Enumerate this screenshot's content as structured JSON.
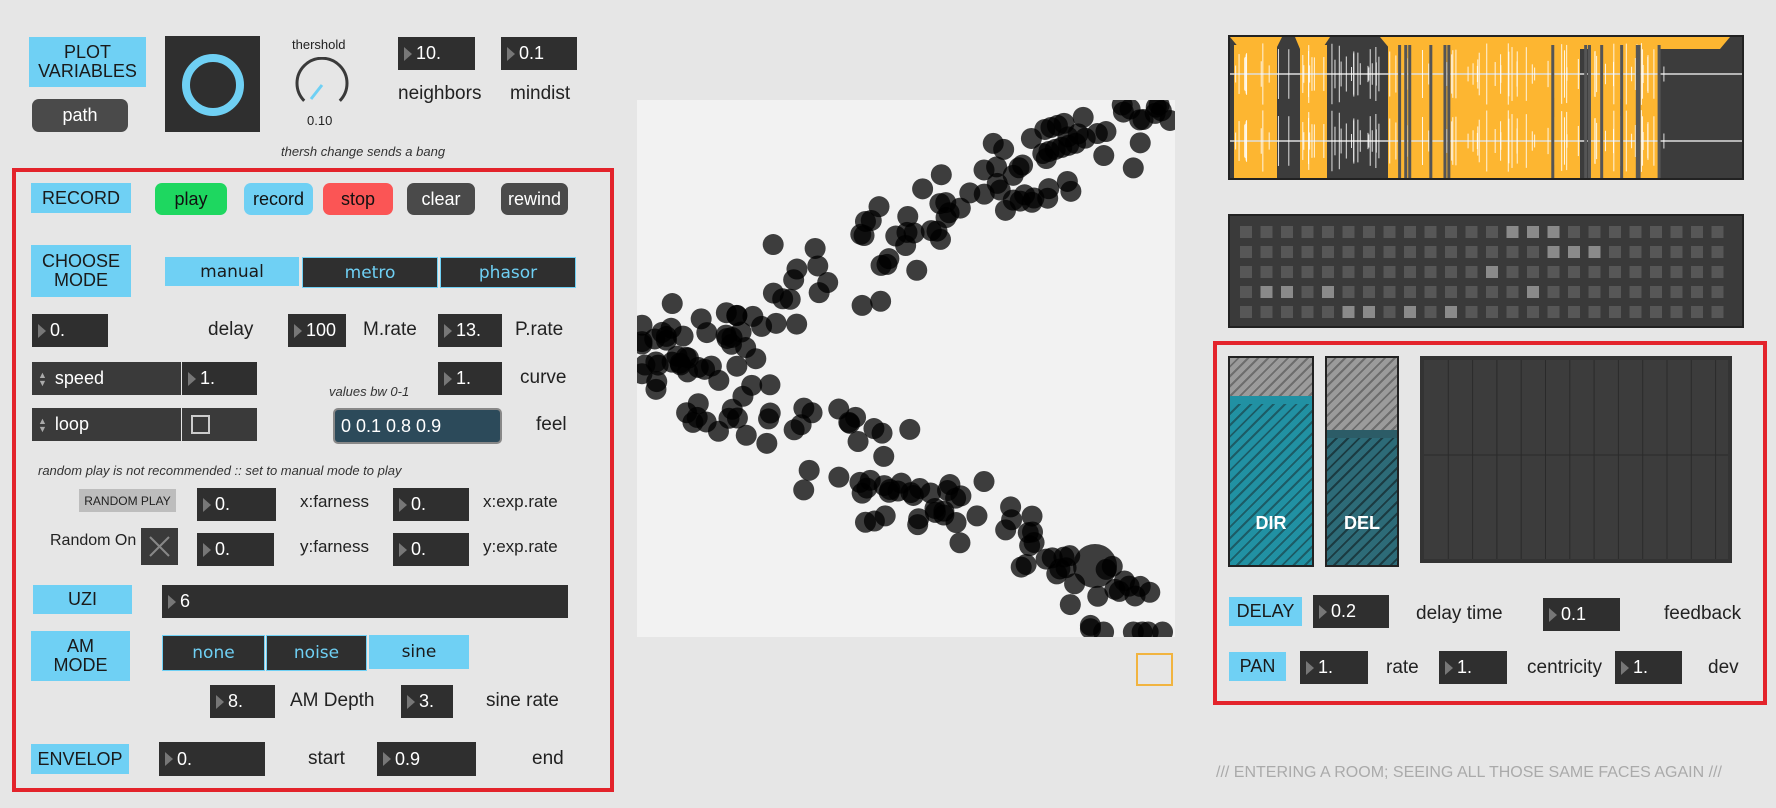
{
  "top": {
    "plot_variables": "PLOT\nVARIABLES",
    "path_btn": "path",
    "thershold_label": "thershold",
    "thershold_value": "0.10",
    "thershold_fraction": 0.1,
    "thersh_note": "thersh change sends a bang",
    "neighbors_value": "10.",
    "neighbors_label": "neighbors",
    "mindist_value": "0.1",
    "mindist_label": "mindist"
  },
  "left": {
    "record_tag": "RECORD",
    "play": "play",
    "record": "record",
    "stop": "stop",
    "clear": "clear",
    "rewind": "rewind",
    "choose_mode": "CHOOSE\nMODE",
    "mode_tabs": [
      "manual",
      "metro",
      "phasor"
    ],
    "delay_value": "0.",
    "delay_label": "delay",
    "mrate_value": "100",
    "mrate_label": "M.rate",
    "prate_value": "13.",
    "prate_label": "P.rate",
    "speed_menu": "speed",
    "speed_value": "1.",
    "curve_value": "1.",
    "curve_label": "curve",
    "values_note": "values bw 0-1",
    "loop_menu": "loop",
    "feel_value": "0 0.1 0.8 0.9",
    "feel_label": "feel",
    "random_note": "random play is not recommended :: set to manual mode to play",
    "random_play": "RANDOM PLAY",
    "random_on": "Random On",
    "xfar_value": "0.",
    "xfar_label": "x:farness",
    "xexp_value": "0.",
    "xexp_label": "x:exp.rate",
    "yfar_value": "0.",
    "yfar_label": "y:farness",
    "yexp_value": "0.",
    "yexp_label": "y:exp.rate",
    "uzi_tag": "UZI",
    "uzi_value": "6",
    "am_mode": "AM\nMODE",
    "am_tabs": [
      "none",
      "noise",
      "sine"
    ],
    "amdepth_value": "8.",
    "amdepth_label": "AM Depth",
    "sinerate_value": "3.",
    "sinerate_label": "sine rate",
    "envelop_tag": "ENVELOP",
    "start_value": "0.",
    "start_label": "start",
    "end_value": "0.9",
    "end_label": "end"
  },
  "right": {
    "dir_label": "DIR",
    "del_label": "DEL",
    "delay_tag": "DELAY",
    "delaytime_value": "0.2",
    "delaytime_label": "delay time",
    "feedback_value": "0.1",
    "feedback_label": "feedback",
    "pan_tag": "PAN",
    "rate_value": "1.",
    "rate_label": "rate",
    "centricity_value": "1.",
    "centricity_label": "centricity",
    "dev_value": "1.",
    "dev_label": "dev",
    "footer": "/// ENTERING A ROOM; SEEING ALL THOSE SAME FACES AGAIN ///"
  },
  "colors": {
    "accent": "#6fd0f4",
    "play": "#1ed760",
    "stop": "#fb5555",
    "frame": "#e3232b",
    "waveform": "#fdb631",
    "slider": "#2191a3"
  }
}
